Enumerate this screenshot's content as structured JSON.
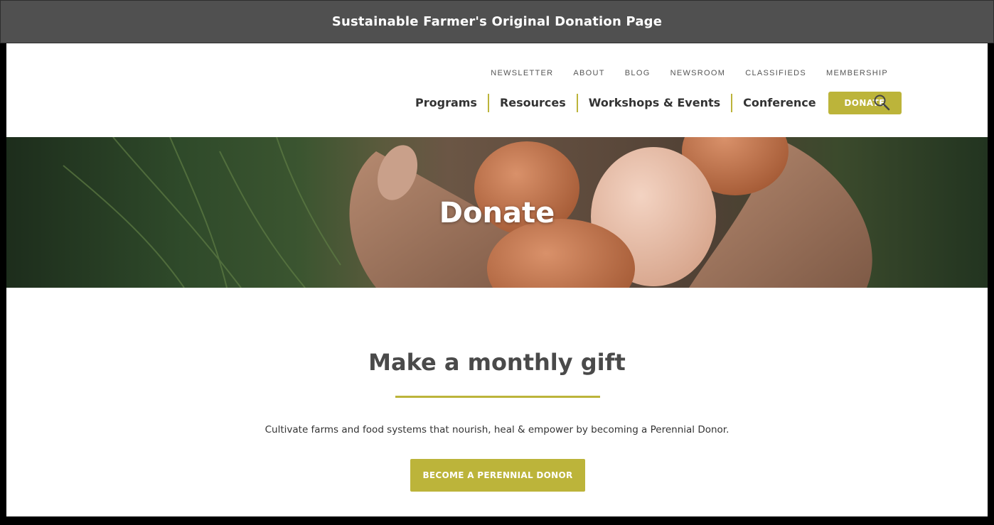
{
  "window": {
    "title": "Sustainable Farmer's Original Donation Page"
  },
  "utility_nav": [
    "NEWSLETTER",
    "ABOUT",
    "BLOG",
    "NEWSROOM",
    "CLASSIFIEDS",
    "MEMBERSHIP"
  ],
  "main_nav": {
    "items": [
      "Programs",
      "Resources",
      "Workshops & Events",
      "Conference"
    ],
    "donate_label": "DONATE",
    "search_icon": "search-icon"
  },
  "hero": {
    "title": "Donate"
  },
  "content": {
    "heading": "Make a monthly gift",
    "text": "Cultivate farms and food systems that nourish, heal & empower by becoming a Perennial Donor.",
    "button_label": "BECOME A PERENNIAL DONOR"
  },
  "colors": {
    "accent": "#bcb43a",
    "title_bar": "#505050",
    "heading": "#4a4a4a"
  }
}
